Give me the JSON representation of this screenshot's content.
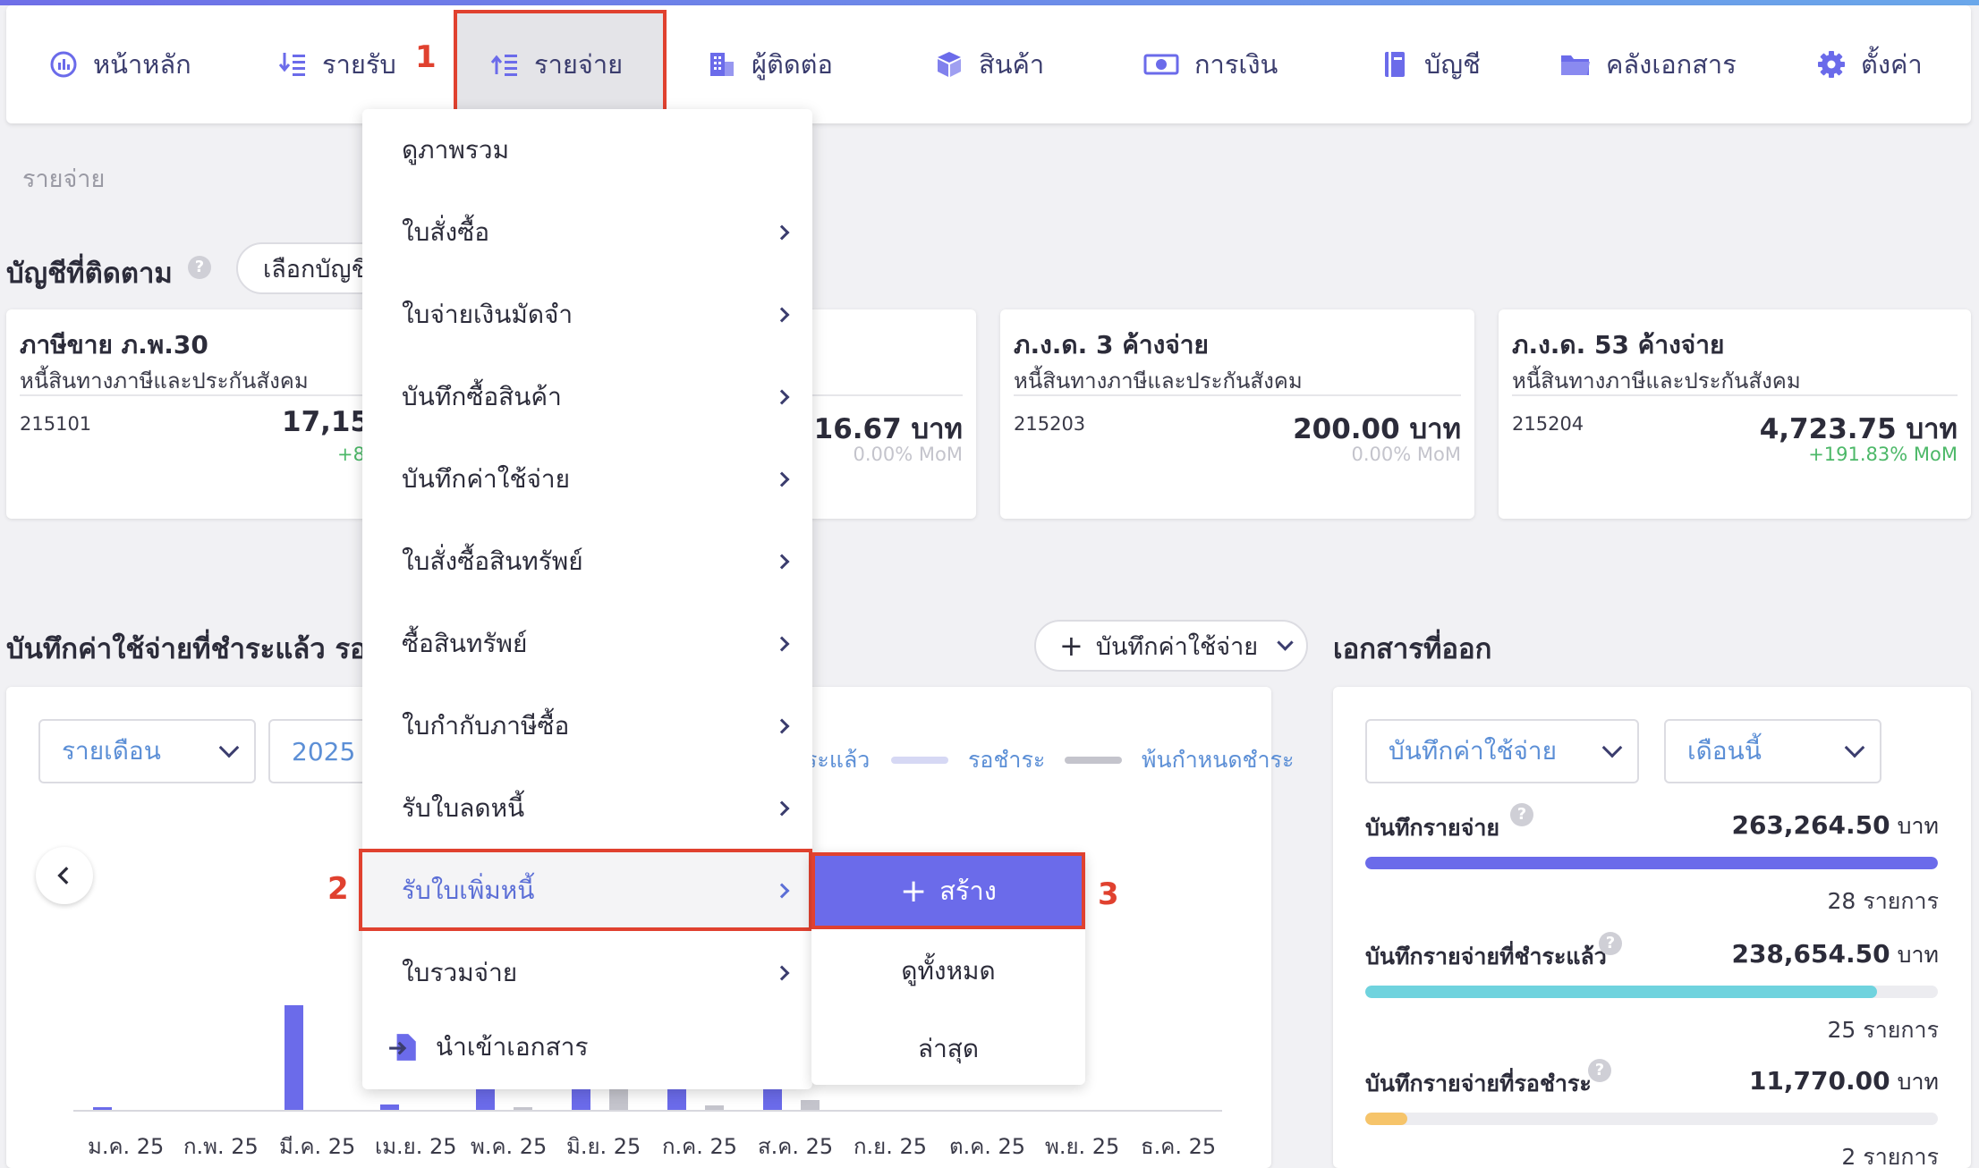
{
  "nav": {
    "items": [
      {
        "label": "หน้าหลัก",
        "icon": "chart-circle-icon"
      },
      {
        "label": "รายรับ",
        "icon": "income-list-icon"
      },
      {
        "label": "รายจ่าย",
        "icon": "expense-list-icon"
      },
      {
        "label": "ผู้ติดต่อ",
        "icon": "building-icon"
      },
      {
        "label": "สินค้า",
        "icon": "box-icon"
      },
      {
        "label": "การเงิน",
        "icon": "money-icon"
      },
      {
        "label": "บัญชี",
        "icon": "ledger-book-icon"
      },
      {
        "label": "คลังเอกสาร",
        "icon": "folder-icon"
      },
      {
        "label": "ตั้งค่า",
        "icon": "gear-icon"
      }
    ],
    "active": "รายจ่าย"
  },
  "callouts": {
    "one": "1",
    "two": "2",
    "three": "3"
  },
  "breadcrumb": "รายจ่าย",
  "tracked": {
    "title": "บัญชีที่ติดตาม",
    "select_label": "เลือกบัญชี",
    "cards": [
      {
        "name": "ภาษีขาย ภ.พ.30",
        "subtitle": "หนี้สินทางภาษีและประกันสังคม",
        "code": "215101",
        "amount": "17,154",
        "mom": "+8"
      },
      {
        "name": "",
        "subtitle": "",
        "code": "",
        "amount": ",616.67 บาท",
        "mom": "0.00% MoM"
      },
      {
        "name": "ภ.ง.ด. 3 ค้างจ่าย",
        "subtitle": "หนี้สินทางภาษีและประกันสังคม",
        "code": "215203",
        "amount": "200.00 บาท",
        "mom": "0.00% MoM"
      },
      {
        "name": "ภ.ง.ด. 53 ค้างจ่าย",
        "subtitle": "หนี้สินทางภาษีและประกันสังคม",
        "code": "215204",
        "amount": "4,723.75 บาท",
        "mom": "+191.83% MoM"
      }
    ]
  },
  "expenses_section": {
    "title": "บันทึกค่าใช้จ่ายที่ชำระแล้ว รอชำ",
    "add_button": "บันทึกค่าใช้จ่าย",
    "period_select": "รายเดือน",
    "year_select": "2025",
    "legend": [
      {
        "label": "ระแล้ว",
        "color": "#6b6bea"
      },
      {
        "label": "รอชำระ",
        "color": "#d6d8f4"
      },
      {
        "label": "พ้นกำหนดชำระ",
        "color": "#c4c4cc"
      }
    ]
  },
  "chart_data": {
    "type": "bar",
    "categories": [
      "ม.ค. 25",
      "ก.พ. 25",
      "มี.ค. 25",
      "เม.ย. 25",
      "พ.ค. 25",
      "มิ.ย. 25",
      "ก.ค. 25",
      "ส.ค. 25",
      "ก.ย. 25",
      "ต.ค. 25",
      "พ.ย. 25",
      "ธ.ค. 25"
    ],
    "series": [
      {
        "name": "ชำระแล้ว",
        "color": "#6b6bea",
        "values": [
          2,
          0,
          73,
          4,
          30,
          30,
          30,
          30,
          0,
          0,
          0,
          0
        ]
      },
      {
        "name": "พ้นกำหนดชำระ",
        "color": "#c4c4cc",
        "values": [
          0,
          0,
          0,
          0,
          1,
          15,
          3,
          7,
          0,
          0,
          0,
          0
        ]
      }
    ],
    "ymax": 100
  },
  "documents": {
    "title": "เอกสารที่ออก",
    "type_select": "บันทึกค่าใช้จ่าย",
    "month_select": "เดือนนี้",
    "stats": [
      {
        "label": "บันทึกรายจ่าย",
        "amount": "263,264.50",
        "unit": "บาท",
        "count": "28 รายการ",
        "fill": 1.0,
        "color": "#6b6bea"
      },
      {
        "label": "บันทึกรายจ่ายที่ชำระแล้ว",
        "amount": "238,654.50",
        "unit": "บาท",
        "count": "25 รายการ",
        "fill": 0.894,
        "color": "#6fd3de"
      },
      {
        "label": "บันทึกรายจ่ายที่รอชำระ",
        "amount": "11,770.00",
        "unit": "บาท",
        "count": "2 รายการ",
        "fill": 0.073,
        "color": "#f6c46a"
      }
    ]
  },
  "menu": {
    "items": [
      {
        "label": "ดูภาพรวม",
        "arrow": false
      },
      {
        "label": "ใบสั่งซื้อ",
        "arrow": true
      },
      {
        "label": "ใบจ่ายเงินมัดจำ",
        "arrow": true
      },
      {
        "label": "บันทึกซื้อสินค้า",
        "arrow": true
      },
      {
        "label": "บันทึกค่าใช้จ่าย",
        "arrow": true
      },
      {
        "label": "ใบสั่งซื้อสินทรัพย์",
        "arrow": true
      },
      {
        "label": "ซื้อสินทรัพย์",
        "arrow": true
      },
      {
        "label": "ใบกำกับภาษีซื้อ",
        "arrow": true
      },
      {
        "label": "รับใบลดหนี้",
        "arrow": true
      },
      {
        "label": "รับใบเพิ่มหนี้",
        "arrow": true
      },
      {
        "label": "ใบรวมจ่าย",
        "arrow": true
      }
    ],
    "import_label": "นำเข้าเอกสาร"
  },
  "submenu": {
    "create": "สร้าง",
    "view_all": "ดูทั้งหมด",
    "latest": "ล่าสุด"
  }
}
